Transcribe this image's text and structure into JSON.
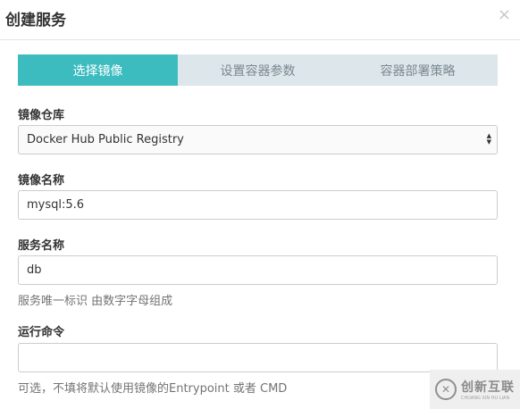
{
  "dialog": {
    "title": "创建服务",
    "close_glyph": "×"
  },
  "steps": [
    {
      "label": "选择镜像",
      "active": true
    },
    {
      "label": "设置容器参数",
      "active": false
    },
    {
      "label": "容器部署策略",
      "active": false
    }
  ],
  "form": {
    "registry": {
      "label": "镜像仓库",
      "selected": "Docker Hub Public Registry"
    },
    "image_name": {
      "label": "镜像名称",
      "value": "mysql:5.6"
    },
    "service_name": {
      "label": "服务名称",
      "value": "db",
      "help": "服务唯一标识 由数字字母组成"
    },
    "command": {
      "label": "运行命令",
      "value": "",
      "help": "可选，不填将默认使用镜像的Entrypoint 或者 CMD"
    }
  },
  "watermark": {
    "text": "创新互联",
    "subtext": "CHUANG XIN HU LIAN"
  },
  "colors": {
    "accent": "#3dbcc0",
    "step_bg": "#dde7eb"
  },
  "icons": {
    "close": "close-icon",
    "select_arrows": "sort-arrows-icon",
    "watermark_logo": "brand-logo-icon"
  }
}
